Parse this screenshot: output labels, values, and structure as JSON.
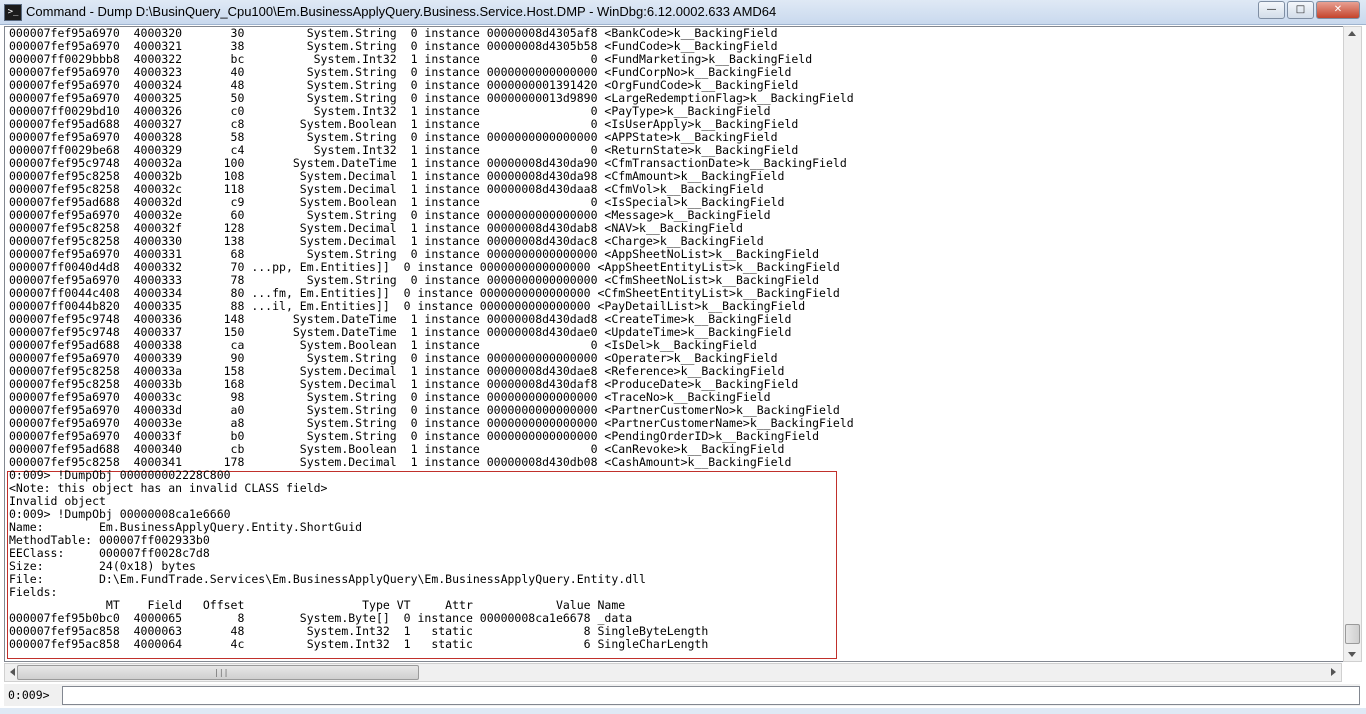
{
  "window": {
    "icon_name": "command-prompt-icon",
    "title": "Command - Dump D:\\BusinQuery_Cpu100\\Em.BusinessApplyQuery.Business.Service.Host.DMP - WinDbg:6.12.0002.633 AMD64",
    "controls": {
      "minimize": "—",
      "maximize": "□",
      "close": "✕"
    }
  },
  "output": {
    "lines": [
      "000007fef95a6970  4000320       30         System.String  0 instance 00000008d4305af8 <BankCode>k__BackingField",
      "000007fef95a6970  4000321       38         System.String  0 instance 00000008d4305b58 <FundCode>k__BackingField",
      "000007ff0029bbb8  4000322       bc          System.Int32  1 instance                0 <FundMarketing>k__BackingField",
      "000007fef95a6970  4000323       40         System.String  0 instance 0000000000000000 <FundCorpNo>k__BackingField",
      "000007fef95a6970  4000324       48         System.String  0 instance 0000000001391420 <OrgFundCode>k__BackingField",
      "000007fef95a6970  4000325       50         System.String  0 instance 00000000013d9890 <LargeRedemptionFlag>k__BackingField",
      "000007ff0029bd10  4000326       c0          System.Int32  1 instance                0 <PayType>k__BackingField",
      "000007fef95ad688  4000327       c8        System.Boolean  1 instance                0 <IsUserApply>k__BackingField",
      "000007fef95a6970  4000328       58         System.String  0 instance 0000000000000000 <APPState>k__BackingField",
      "000007ff0029be68  4000329       c4          System.Int32  1 instance                0 <ReturnState>k__BackingField",
      "000007fef95c9748  400032a      100       System.DateTime  1 instance 00000008d430da90 <CfmTransactionDate>k__BackingField",
      "000007fef95c8258  400032b      108        System.Decimal  1 instance 00000008d430da98 <CfmAmount>k__BackingField",
      "000007fef95c8258  400032c      118        System.Decimal  1 instance 00000008d430daa8 <CfmVol>k__BackingField",
      "000007fef95ad688  400032d       c9        System.Boolean  1 instance                0 <IsSpecial>k__BackingField",
      "000007fef95a6970  400032e       60         System.String  0 instance 0000000000000000 <Message>k__BackingField",
      "000007fef95c8258  400032f      128        System.Decimal  1 instance 00000008d430dab8 <NAV>k__BackingField",
      "000007fef95c8258  4000330      138        System.Decimal  1 instance 00000008d430dac8 <Charge>k__BackingField",
      "000007fef95a6970  4000331       68         System.String  0 instance 0000000000000000 <AppSheetNoList>k__BackingField",
      "000007ff0040d4d8  4000332       70 ...pp, Em.Entities]]  0 instance 0000000000000000 <AppSheetEntityList>k__BackingField",
      "000007fef95a6970  4000333       78         System.String  0 instance 0000000000000000 <CfmSheetNoList>k__BackingField",
      "000007ff0044c408  4000334       80 ...fm, Em.Entities]]  0 instance 0000000000000000 <CfmSheetEntityList>k__BackingField",
      "000007ff0044b820  4000335       88 ...il, Em.Entities]]  0 instance 0000000000000000 <PayDetailList>k__BackingField",
      "000007fef95c9748  4000336      148       System.DateTime  1 instance 00000008d430dad8 <CreateTime>k__BackingField",
      "000007fef95c9748  4000337      150       System.DateTime  1 instance 00000008d430dae0 <UpdateTime>k__BackingField",
      "000007fef95ad688  4000338       ca        System.Boolean  1 instance                0 <IsDel>k__BackingField",
      "000007fef95a6970  4000339       90         System.String  0 instance 0000000000000000 <Operater>k__BackingField",
      "000007fef95c8258  400033a      158        System.Decimal  1 instance 00000008d430dae8 <Reference>k__BackingField",
      "000007fef95c8258  400033b      168        System.Decimal  1 instance 00000008d430daf8 <ProduceDate>k__BackingField",
      "000007fef95a6970  400033c       98         System.String  0 instance 0000000000000000 <TraceNo>k__BackingField",
      "000007fef95a6970  400033d       a0         System.String  0 instance 0000000000000000 <PartnerCustomerNo>k__BackingField",
      "000007fef95a6970  400033e       a8         System.String  0 instance 0000000000000000 <PartnerCustomerName>k__BackingField",
      "000007fef95a6970  400033f       b0         System.String  0 instance 0000000000000000 <PendingOrderID>k__BackingField",
      "000007fef95ad688  4000340       cb        System.Boolean  1 instance                0 <CanRevoke>k__BackingField",
      "000007fef95c8258  4000341      178        System.Decimal  1 instance 00000008d430db08 <CashAmount>k__BackingField",
      "0:009> !DumpObj 000000002228C800",
      "<Note: this object has an invalid CLASS field>",
      "Invalid object",
      "0:009> !DumpObj 00000008ca1e6660",
      "Name:        Em.BusinessApplyQuery.Entity.ShortGuid",
      "MethodTable: 000007ff002933b0",
      "EEClass:     000007ff0028c7d8",
      "Size:        24(0x18) bytes",
      "File:        D:\\Em.FundTrade.Services\\Em.BusinessApplyQuery\\Em.BusinessApplyQuery.Entity.dll",
      "Fields:",
      "              MT    Field   Offset                 Type VT     Attr            Value Name",
      "000007fef95b0bc0  4000065        8        System.Byte[]  0 instance 00000008ca1e6678 _data",
      "000007fef95ac858  4000063       48         System.Int32  1   static                8 SingleByteLength",
      "000007fef95ac858  4000064       4c         System.Int32  1   static                6 SingleCharLength"
    ]
  },
  "command": {
    "prompt": "0:009>",
    "value": ""
  },
  "scrollbar": {
    "grip": "|||"
  }
}
